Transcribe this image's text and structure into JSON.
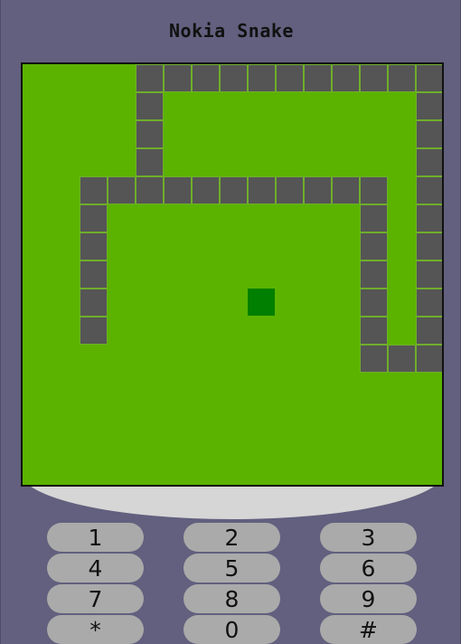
{
  "app": {
    "title": "Nokia Snake"
  },
  "colors": {
    "phone_body": "#62607e",
    "screen_bg": "#5bb300",
    "snake": "#555555",
    "food": "#007f00",
    "key": "#aaaaaa",
    "chin": "#d6d6d6"
  },
  "game": {
    "grid_cols": 15,
    "grid_rows": 15,
    "snake_cells": [
      [
        4,
        3
      ],
      [
        4,
        2
      ],
      [
        4,
        1
      ],
      [
        4,
        0
      ],
      [
        5,
        0
      ],
      [
        6,
        0
      ],
      [
        7,
        0
      ],
      [
        8,
        0
      ],
      [
        9,
        0
      ],
      [
        10,
        0
      ],
      [
        11,
        0
      ],
      [
        12,
        0
      ],
      [
        13,
        0
      ],
      [
        14,
        0
      ],
      [
        14,
        1
      ],
      [
        14,
        2
      ],
      [
        14,
        3
      ],
      [
        14,
        4
      ],
      [
        14,
        5
      ],
      [
        14,
        6
      ],
      [
        14,
        7
      ],
      [
        14,
        8
      ],
      [
        14,
        9
      ],
      [
        14,
        10
      ],
      [
        13,
        10
      ],
      [
        12,
        10
      ],
      [
        12,
        9
      ],
      [
        12,
        8
      ],
      [
        12,
        7
      ],
      [
        12,
        6
      ],
      [
        12,
        5
      ],
      [
        12,
        4
      ],
      [
        11,
        4
      ],
      [
        10,
        4
      ],
      [
        9,
        4
      ],
      [
        8,
        4
      ],
      [
        7,
        4
      ],
      [
        6,
        4
      ],
      [
        5,
        4
      ],
      [
        4,
        4
      ],
      [
        3,
        4
      ],
      [
        2,
        4
      ],
      [
        2,
        5
      ],
      [
        2,
        6
      ],
      [
        2,
        7
      ],
      [
        2,
        8
      ],
      [
        2,
        9
      ]
    ],
    "food_cell": [
      8,
      8
    ]
  },
  "keypad": {
    "keys": [
      "1",
      "2",
      "3",
      "4",
      "5",
      "6",
      "7",
      "8",
      "9",
      "*",
      "0",
      "#"
    ]
  }
}
